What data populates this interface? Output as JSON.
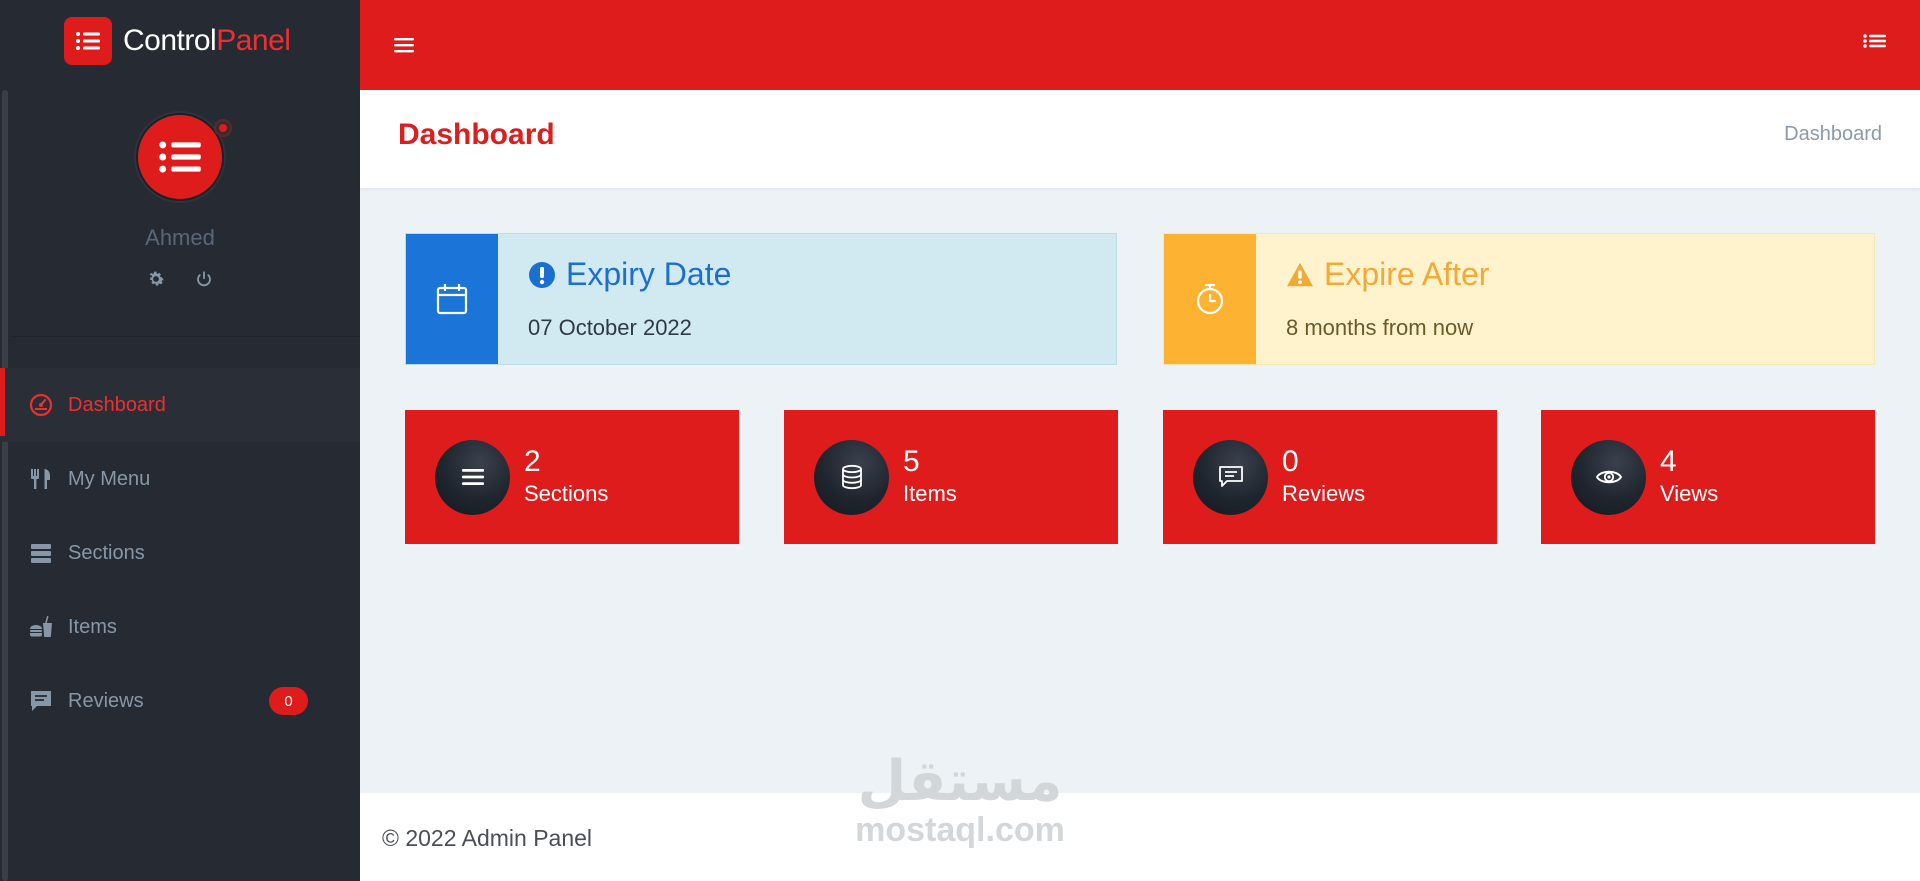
{
  "brand": {
    "name_primary": "Control",
    "name_accent": "Panel"
  },
  "user": {
    "name": "Ahmed"
  },
  "sidebar": {
    "items": [
      {
        "label": "Dashboard",
        "icon": "dashboard-gauge-icon",
        "active": true
      },
      {
        "label": "My Menu",
        "icon": "utensils-icon"
      },
      {
        "label": "Sections",
        "icon": "list-rows-icon"
      },
      {
        "label": "Items",
        "icon": "burger-drink-icon"
      },
      {
        "label": "Reviews",
        "icon": "comment-icon",
        "badge": "0"
      }
    ]
  },
  "topbar": {
    "menu_icon": "hamburger-icon",
    "right_icon": "list-icon"
  },
  "header": {
    "title": "Dashboard",
    "breadcrumb": "Dashboard"
  },
  "info_boxes": {
    "expiry": {
      "title": "Expiry Date",
      "value": "07 October 2022",
      "color": "#1b74d7"
    },
    "expire_after": {
      "title": "Expire After",
      "value": "8 months from now",
      "color": "#fdb331"
    }
  },
  "stats": [
    {
      "value": "2",
      "label": "Sections",
      "icon": "bars-icon"
    },
    {
      "value": "5",
      "label": "Items",
      "icon": "database-icon"
    },
    {
      "value": "0",
      "label": "Reviews",
      "icon": "comment-icon"
    },
    {
      "value": "4",
      "label": "Views",
      "icon": "eye-icon"
    }
  ],
  "footer": {
    "text": "© 2022 Admin Panel"
  },
  "watermark": {
    "arabic": "مستقل",
    "latin": "mostaql.com"
  },
  "colors": {
    "primary": "#df1c1c",
    "sidebar": "#262b33",
    "background": "#edf2f6"
  }
}
